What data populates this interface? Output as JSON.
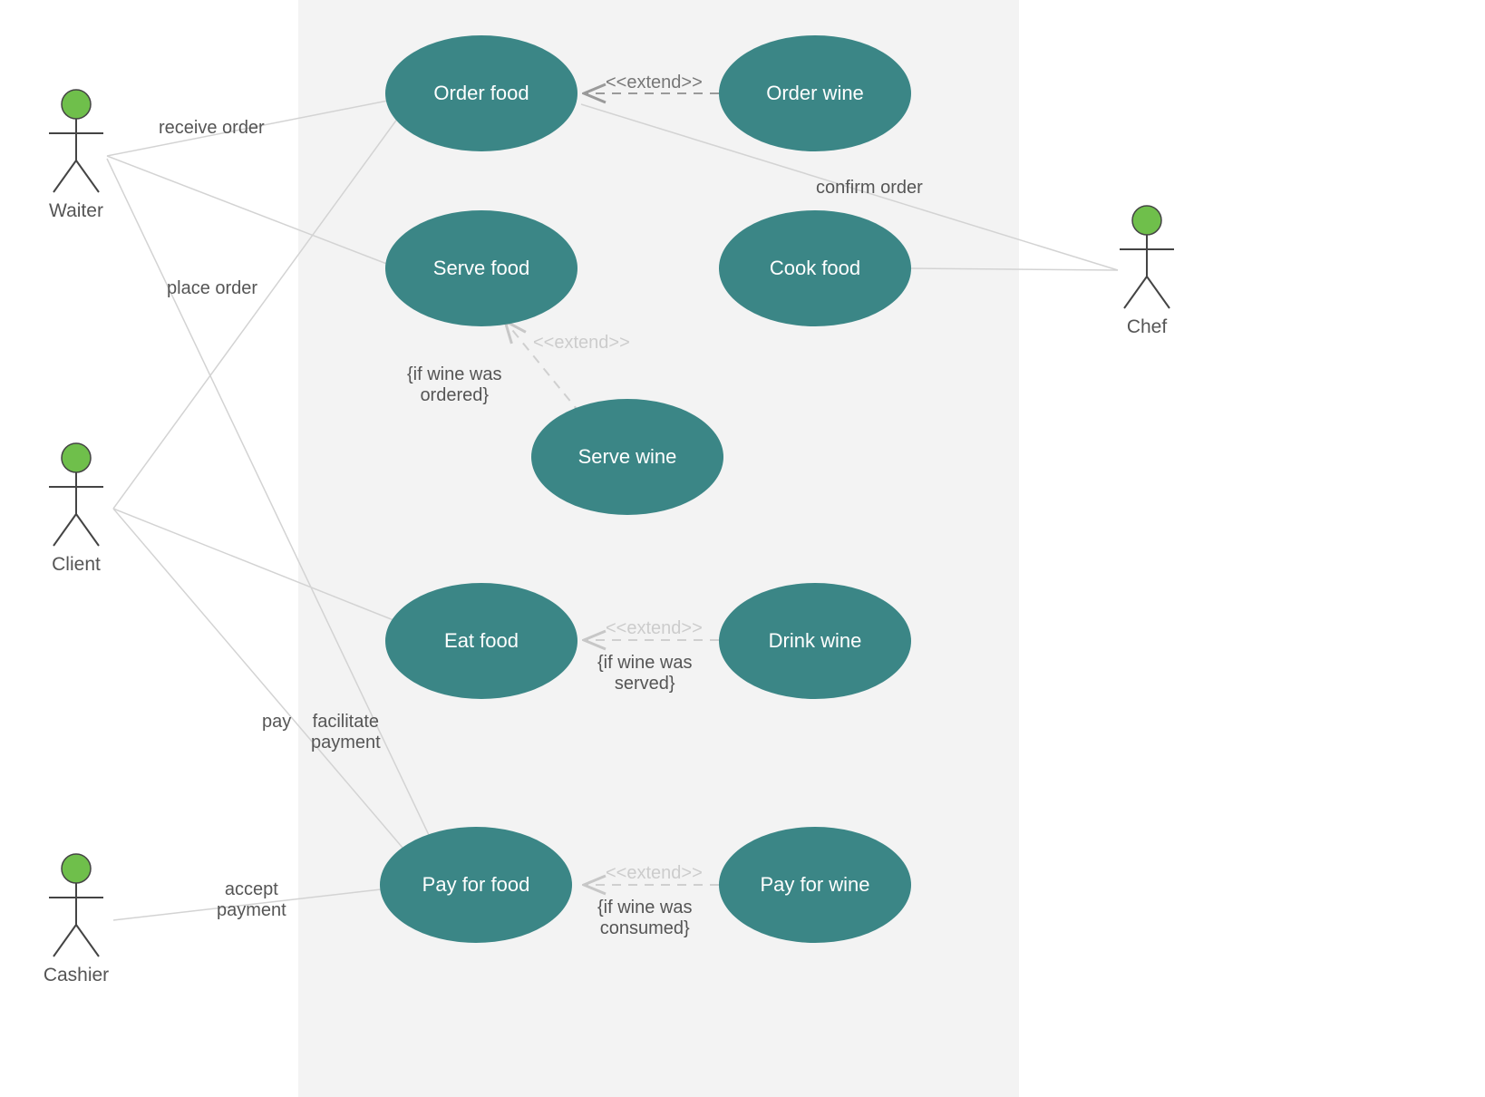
{
  "actors": {
    "waiter": "Waiter",
    "client": "Client",
    "cashier": "Cashier",
    "chef": "Chef"
  },
  "usecases": {
    "order_food": "Order food",
    "order_wine": "Order wine",
    "serve_food": "Serve food",
    "cook_food": "Cook food",
    "serve_wine": "Serve wine",
    "eat_food": "Eat food",
    "drink_wine": "Drink wine",
    "pay_for_food": "Pay for food",
    "pay_for_wine": "Pay for wine"
  },
  "edges": {
    "receive_order": "receive order",
    "place_order": "place order",
    "confirm_order": "confirm order",
    "pay": "pay",
    "facilitate_payment": "facilitate\npayment",
    "accept_payment": "accept\npayment",
    "extend": "<<extend>>",
    "cond_serve": "{if wine was\nordered}",
    "cond_eat": "{if wine was\nserved}",
    "cond_pay": "{if wine was\nconsumed}"
  }
}
